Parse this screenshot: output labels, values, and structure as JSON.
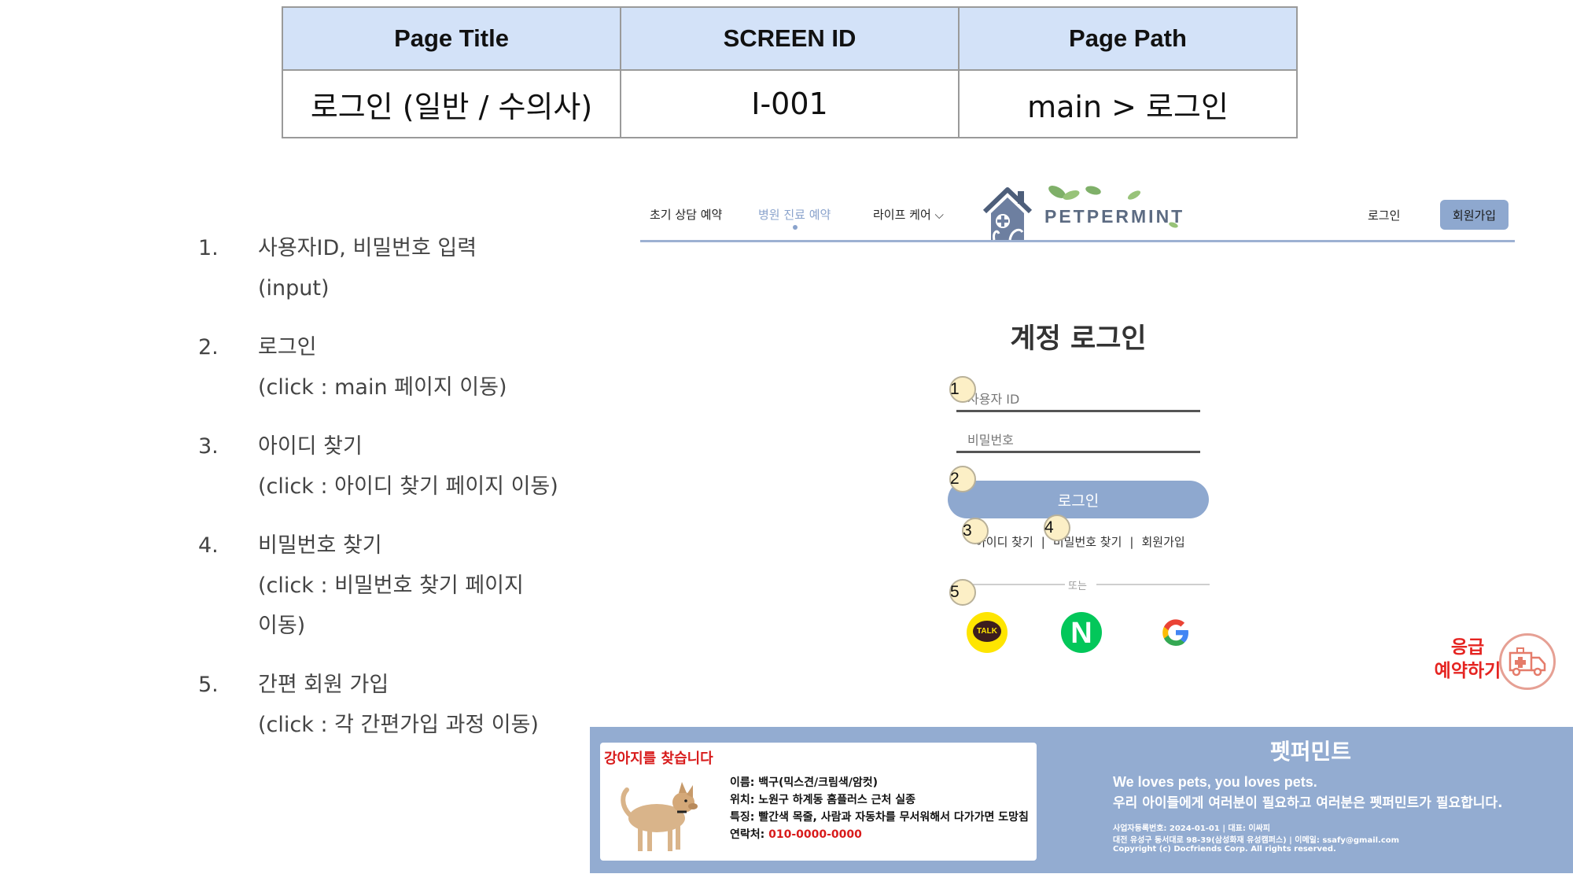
{
  "spec_table": {
    "headers": [
      "Page Title",
      "SCREEN ID",
      "Page Path"
    ],
    "values": [
      "로그인 (일반 / 수의사)",
      "I-001",
      "main > 로그인"
    ]
  },
  "notes": [
    {
      "num": "1.",
      "title": "사용자ID, 비밀번호 입력",
      "desc": "(input)"
    },
    {
      "num": "2.",
      "title": "로그인",
      "desc": "(click : main 페이지 이동)"
    },
    {
      "num": "3.",
      "title": "아이디 찾기",
      "desc": "(click : 아이디 찾기 페이지 이동)"
    },
    {
      "num": "4.",
      "title": "비밀번호 찾기",
      "desc": "(click : 비밀번호 찾기 페이지",
      "desc2": "이동)"
    },
    {
      "num": "5.",
      "title": "간편 회원 가입",
      "desc": "(click : 각 간편가입 과정 이동)"
    }
  ],
  "nav": {
    "items": [
      "초기 상담 예약",
      "병원 진료 예약",
      "라이프 케어 ⌵"
    ],
    "active_index": 1,
    "logo_text": "PETPERMINT",
    "login": "로그인",
    "signup": "회원가입"
  },
  "login": {
    "title": "계정 로그인",
    "id_placeholder": "사용자 ID",
    "pw_placeholder": "비밀번호",
    "button": "로그인",
    "find_id": "아이디 찾기",
    "find_pw": "비밀번호 찾기",
    "signup": "회원가입",
    "or": "또는",
    "kakao_label": "TALK",
    "naver_label": "N"
  },
  "markers": [
    "1",
    "2",
    "3",
    "4",
    "5"
  ],
  "emergency": {
    "line1": "응급",
    "line2": "예약하기"
  },
  "footer": {
    "lost_title": "강아지를 찾습니다",
    "lost_lines": [
      {
        "label": "이름:",
        "value": "백구(믹스견/크림색/암컷)"
      },
      {
        "label": "위치:",
        "value": "노원구 하계동 홈플러스 근처 실종"
      },
      {
        "label": "특징:",
        "value": "빨간색 목줄, 사람과 자동차를 무서워해서 다가가면 도망침"
      }
    ],
    "contact_label": "연락처:",
    "contact_value": "010-0000-0000",
    "brand": "펫퍼민트",
    "tagline1": "We loves pets, you loves pets.",
    "tagline2": "우리 아이들에게 여러분이 필요하고 여러분은 펫퍼민트가 필요합니다.",
    "info1": "사업자등록번호: 2024-01-01 | 대표: 이싸피",
    "info2": "대전 유성구 동서대로 98-39(삼성화재 유성캠퍼스) | 이메일: ssafy@gmail.com",
    "info3": "Copyright (c) Docfriends Corp. All rights reserved."
  },
  "colors": {
    "accent": "#8ea8cf",
    "header_fill": "#d3e2f8",
    "footer": "#93acd1",
    "kakao": "#fee500",
    "naver": "#03c75a",
    "alert_red": "#e52421"
  }
}
